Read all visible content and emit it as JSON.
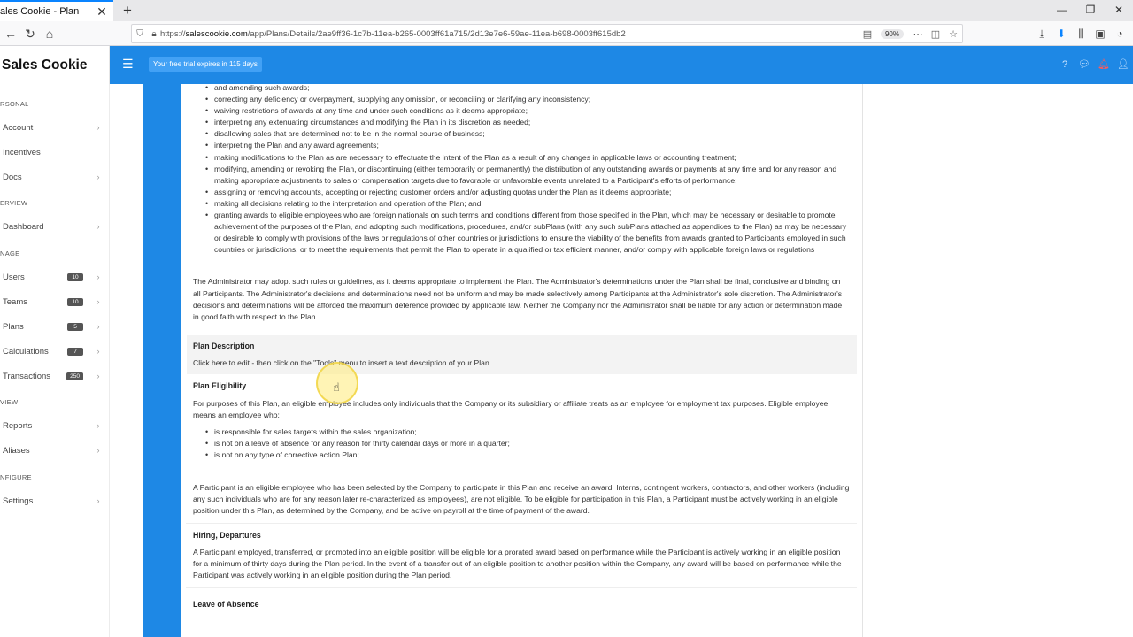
{
  "browser": {
    "tab_title": "ales Cookie - Plan",
    "url_prefix": "https://",
    "url_domain": "salescookie.com",
    "url_path": "/app/Plans/Details/2ae9ff36-1c7b-11ea-b265-0003ff61a715/2d13e7e6-59ae-11ea-b698-0003ff615db2",
    "zoom": "90%"
  },
  "app": {
    "brand": "Sales Cookie",
    "trial_text": "Your free trial expires in 115 days",
    "accent_color": "#1e88e5"
  },
  "sidebar": {
    "sections": [
      {
        "label": "RSONAL"
      },
      {
        "label": "ERVIEW"
      },
      {
        "label": "NAGE"
      },
      {
        "label": "VIEW"
      },
      {
        "label": "NFIGURE"
      }
    ],
    "items": [
      {
        "label": "Account",
        "badge": ""
      },
      {
        "label": "Incentives",
        "badge": ""
      },
      {
        "label": "Docs",
        "badge": ""
      },
      {
        "label": "Dashboard",
        "badge": ""
      },
      {
        "label": "Users",
        "badge": "10"
      },
      {
        "label": "Teams",
        "badge": "10"
      },
      {
        "label": "Plans",
        "badge": "5"
      },
      {
        "label": "Calculations",
        "badge": "7"
      },
      {
        "label": "Transactions",
        "badge": "250"
      },
      {
        "label": "Reports",
        "badge": ""
      },
      {
        "label": "Aliases",
        "badge": ""
      },
      {
        "label": "Settings",
        "badge": ""
      }
    ]
  },
  "content": {
    "top_fragment": "and amending such awards;",
    "bullets1": [
      "correcting any deficiency or overpayment, supplying any omission, or reconciling or clarifying any inconsistency;",
      "waiving restrictions of awards at any time and under such conditions as it deems appropriate;",
      "interpreting any extenuating circumstances and modifying the Plan in its discretion as needed;",
      "disallowing sales that are determined not to be in the normal course of business;",
      "interpreting the Plan and any award agreements;",
      "making modifications to the Plan as are necessary to effectuate the intent of the Plan as a result of any changes in applicable laws or accounting treatment;",
      "modifying, amending or revoking the Plan, or discontinuing (either temporarily or permanently) the distribution of any outstanding awards or payments at any time and for any reason and making appropriate adjustments to sales or compensation targets due to favorable or unfavorable events unrelated to a Participant's efforts of performance;",
      "assigning or removing accounts, accepting or rejecting customer orders and/or adjusting quotas under the Plan as it deems appropriate;",
      "making all decisions relating to the interpretation and operation of the Plan; and",
      "granting awards to eligible employees who are foreign nationals on such terms and conditions different from those specified in the Plan, which may be necessary or desirable to promote achievement of the purposes of the Plan, and adopting such modifications, procedures, and/or subPlans (with any such subPlans attached as appendices to the Plan) as may be necessary or desirable to comply with provisions of the laws or regulations of other countries or jurisdictions to ensure the viability of the benefits from awards granted to Participants employed in such countries or jurisdictions, or to meet the requirements that permit the Plan to operate in a qualified or tax efficient manner, and/or comply with applicable foreign laws or regulations"
    ],
    "admin_para": "The Administrator may adopt such rules or guidelines, as it deems appropriate to implement the Plan. The Administrator's determinations under the Plan shall be final, conclusive and binding on all Participants. The Administrator's decisions and determinations need not be uniform and may be made selectively among Participants at the Administrator's sole discretion. The Administrator's decisions and determinations will be afforded the maximum deference provided by applicable law. Neither the Company nor the Administrator shall be liable for any action or determination made in good faith with respect to the Plan.",
    "desc_heading": "Plan Description",
    "desc_text": "Click here to edit - then click on the \"Tools\" menu to insert a text description of your Plan.",
    "elig_heading": "Plan Eligibility",
    "elig_para": "For purposes of this Plan, an eligible employee includes only individuals that the Company or its subsidiary or affiliate treats as an employee for employment tax purposes. Eligible employee means an employee who:",
    "bullets2": [
      "is responsible for sales targets within the sales organization;",
      "is not on a leave of absence for any reason for thirty calendar days or more in a quarter;",
      "is not on any type of corrective action Plan;"
    ],
    "participant_para": "A Participant is an eligible employee who has been selected by the Company to participate in this Plan and receive an award. Interns, contingent workers, contractors, and other workers (including any such individuals who are for any reason later re-characterized as employees), are not eligible. To be eligible for participation in this Plan, a Participant must be actively working in an eligible position under this Plan, as determined by the Company, and be active on payroll at the time of payment of the award.",
    "hiring_heading": "Hiring, Departures",
    "hiring_para": "A Participant employed, transferred, or promoted into an eligible position will be eligible for a prorated award based on performance while the Participant is actively working in an eligible position for a minimum of thirty days during the Plan period. In the event of a transfer out of an eligible position to another position within the Company, any award will be based on performance while the Participant was actively working in an eligible position during the Plan period.",
    "leave_heading": "Leave of Absence"
  }
}
